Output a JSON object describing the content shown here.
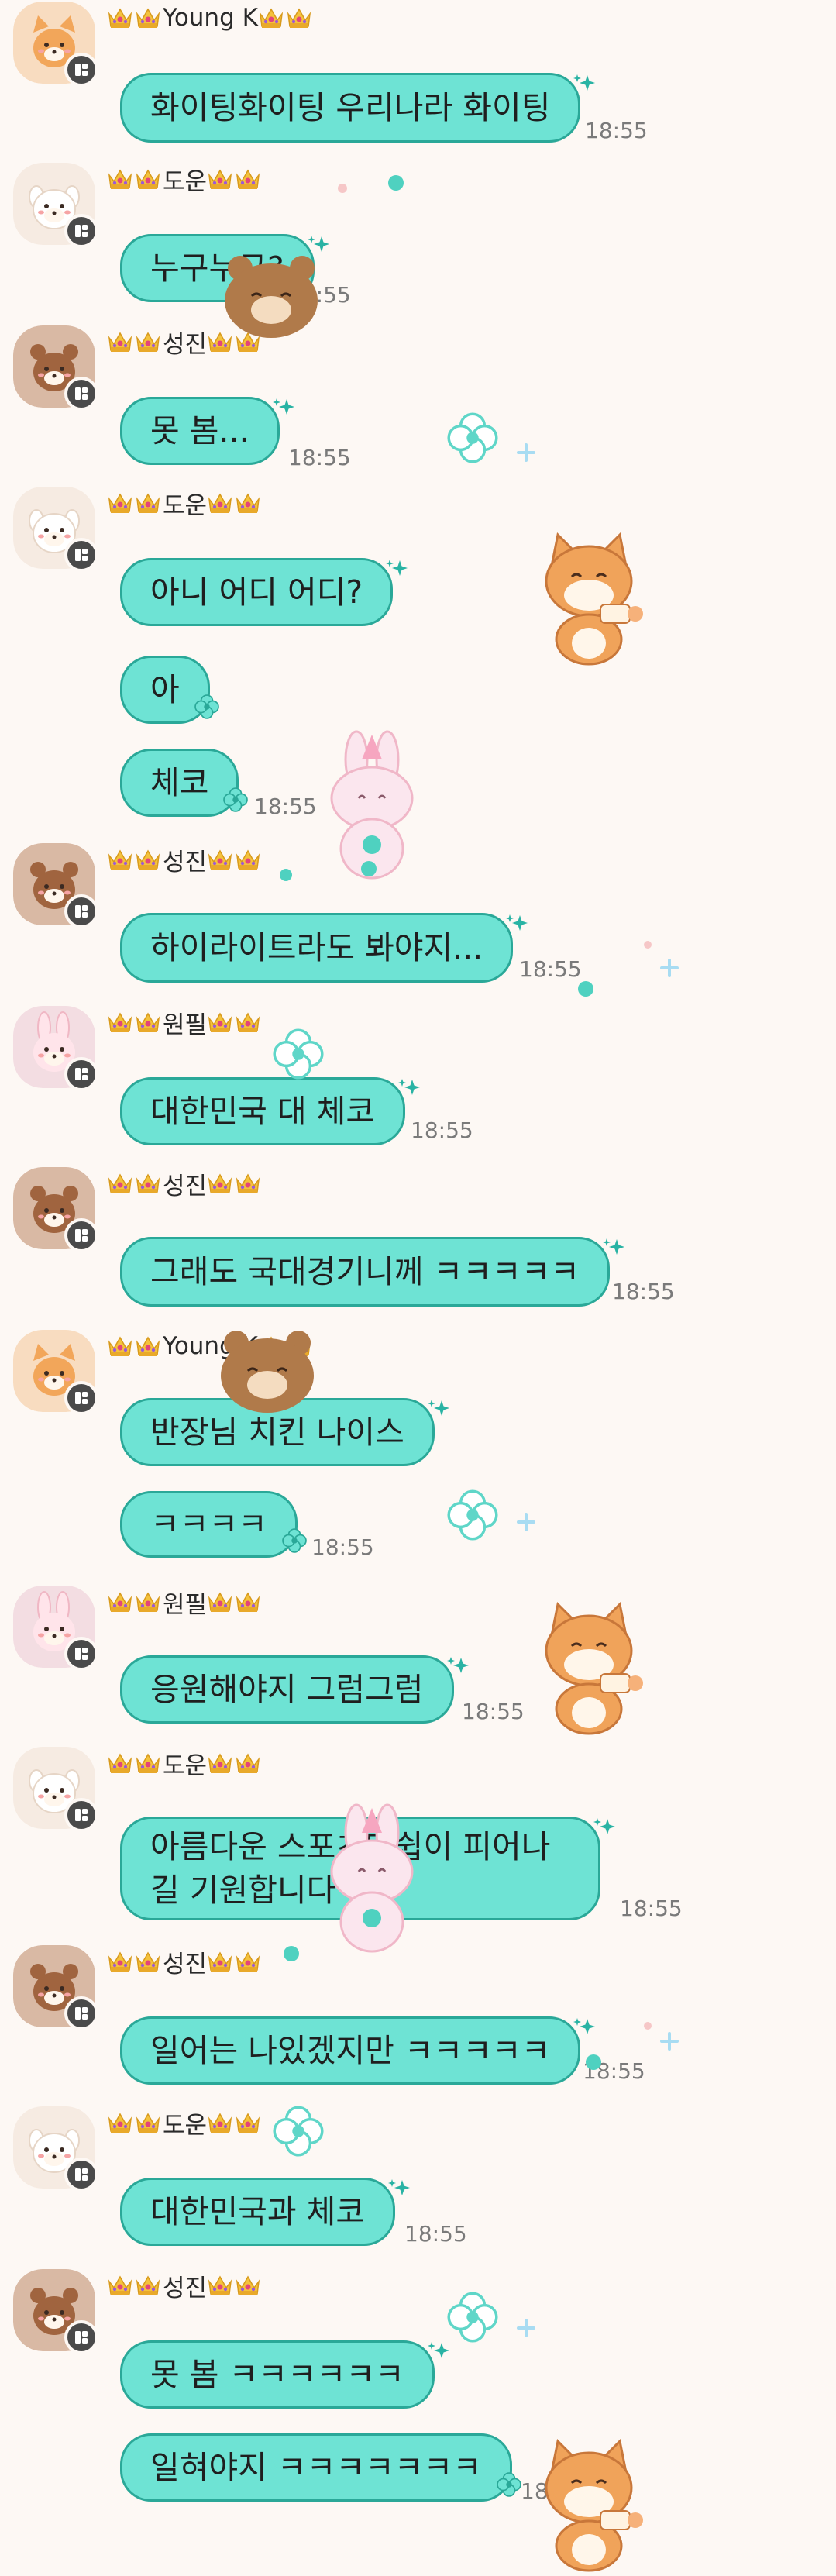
{
  "colors": {
    "background": "#fdf8f4",
    "bubble_fill": "#6ee3d4",
    "bubble_border": "#2aa898",
    "time_text": "#7a7a7a",
    "badge": "#4a4a4a"
  },
  "crown_prefix_icon": "crown-icon",
  "messages": [
    {
      "sender": "Young K",
      "avatar": "fox-avatar",
      "text": "화이팅화이팅 우리나라 화이팅",
      "time": "18:55"
    },
    {
      "sender": "도운",
      "avatar": "puppy-avatar",
      "text": "누구누구?",
      "time": "18:55"
    },
    {
      "sender": "성진",
      "avatar": "bear-avatar",
      "text": "못 봄...",
      "time": "18:55"
    },
    {
      "sender": "도운",
      "avatar": "puppy-avatar",
      "text": "아니 어디 어디?",
      "time": ""
    },
    {
      "sender": "",
      "text": "아",
      "time": ""
    },
    {
      "sender": "",
      "text": "체코",
      "time": "18:55"
    },
    {
      "sender": "성진",
      "avatar": "bear-avatar",
      "text": "하이라이트라도 봐야지...",
      "time": "18:55"
    },
    {
      "sender": "원필",
      "avatar": "bunny-avatar",
      "text": "대한민국 대 체코",
      "time": "18:55"
    },
    {
      "sender": "성진",
      "avatar": "bear-avatar",
      "text": "그래도 국대경기니께 ㅋㅋㅋㅋㅋ",
      "time": "18:55"
    },
    {
      "sender": "Young K",
      "avatar": "fox-avatar",
      "text": "반장님 치킨 나이스",
      "time": ""
    },
    {
      "sender": "",
      "text": "ㅋㅋㅋㅋ",
      "time": "18:55"
    },
    {
      "sender": "원필",
      "avatar": "bunny-avatar",
      "text": "응원해야지 그럼그럼",
      "time": "18:55"
    },
    {
      "sender": "도운",
      "avatar": "puppy-avatar",
      "text": "아름다운 스포츠맨쉽이 피어나길 기원합니다",
      "time": "18:55"
    },
    {
      "sender": "성진",
      "avatar": "bear-avatar",
      "text": "일어는 나있겠지만 ㅋㅋㅋㅋㅋ",
      "time": "18:55"
    },
    {
      "sender": "도운",
      "avatar": "puppy-avatar",
      "text": "대한민국과 체코",
      "time": "18:55"
    },
    {
      "sender": "성진",
      "avatar": "bear-avatar",
      "text": "못 봄 ㅋㅋㅋㅋㅋㅋ",
      "time": ""
    },
    {
      "sender": "",
      "text": "일혀야지 ㅋㅋㅋㅋㅋㅋㅋ",
      "time": "18:55"
    }
  ]
}
